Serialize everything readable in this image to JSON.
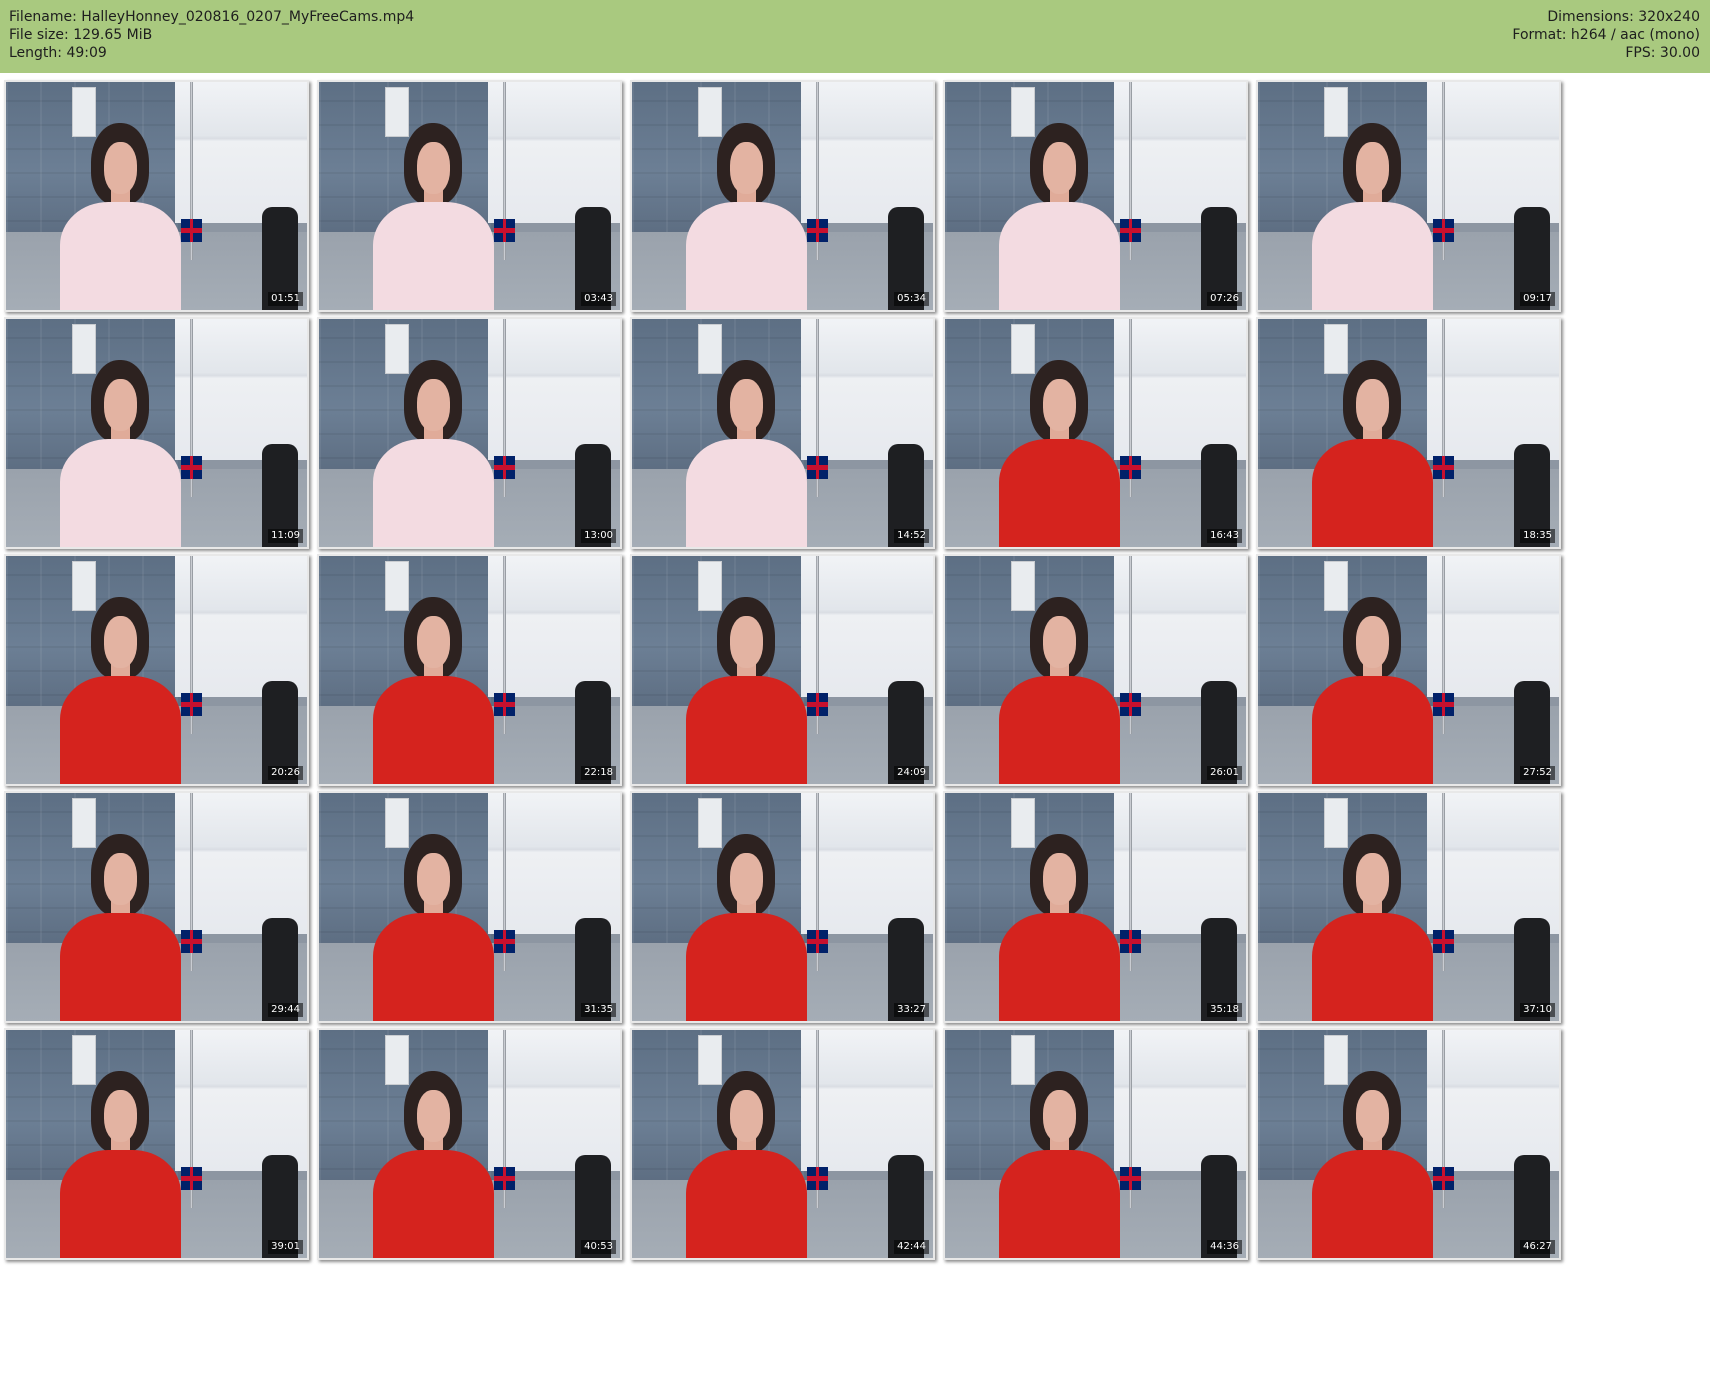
{
  "header": {
    "filename_label": "Filename: HalleyHonney_020816_0207_MyFreeCams.mp4",
    "filesize_label": "File size: 129.65 MiB",
    "length_label": "Length: 49:09",
    "dimensions_label": "Dimensions: 320x240",
    "format_label": "Format: h264 / aac (mono)",
    "fps_label": "FPS: 30.00",
    "background_color": "#a9c97f"
  },
  "thumbnails": [
    {
      "timestamp": "01:51",
      "outfit": "shirt"
    },
    {
      "timestamp": "03:43",
      "outfit": "shirt"
    },
    {
      "timestamp": "05:34",
      "outfit": "shirt"
    },
    {
      "timestamp": "07:26",
      "outfit": "shirt"
    },
    {
      "timestamp": "09:17",
      "outfit": "shirt"
    },
    {
      "timestamp": "11:09",
      "outfit": "shirt"
    },
    {
      "timestamp": "13:00",
      "outfit": "shirt"
    },
    {
      "timestamp": "14:52",
      "outfit": "shirt"
    },
    {
      "timestamp": "16:43",
      "outfit": "red"
    },
    {
      "timestamp": "18:35",
      "outfit": "red"
    },
    {
      "timestamp": "20:26",
      "outfit": "red"
    },
    {
      "timestamp": "22:18",
      "outfit": "red"
    },
    {
      "timestamp": "24:09",
      "outfit": "red"
    },
    {
      "timestamp": "26:01",
      "outfit": "red"
    },
    {
      "timestamp": "27:52",
      "outfit": "red"
    },
    {
      "timestamp": "29:44",
      "outfit": "red"
    },
    {
      "timestamp": "31:35",
      "outfit": "red"
    },
    {
      "timestamp": "33:27",
      "outfit": "red"
    },
    {
      "timestamp": "35:18",
      "outfit": "red"
    },
    {
      "timestamp": "37:10",
      "outfit": "red"
    },
    {
      "timestamp": "39:01",
      "outfit": "red"
    },
    {
      "timestamp": "40:53",
      "outfit": "red"
    },
    {
      "timestamp": "42:44",
      "outfit": "red"
    },
    {
      "timestamp": "44:36",
      "outfit": "red"
    },
    {
      "timestamp": "46:27",
      "outfit": "red"
    }
  ]
}
